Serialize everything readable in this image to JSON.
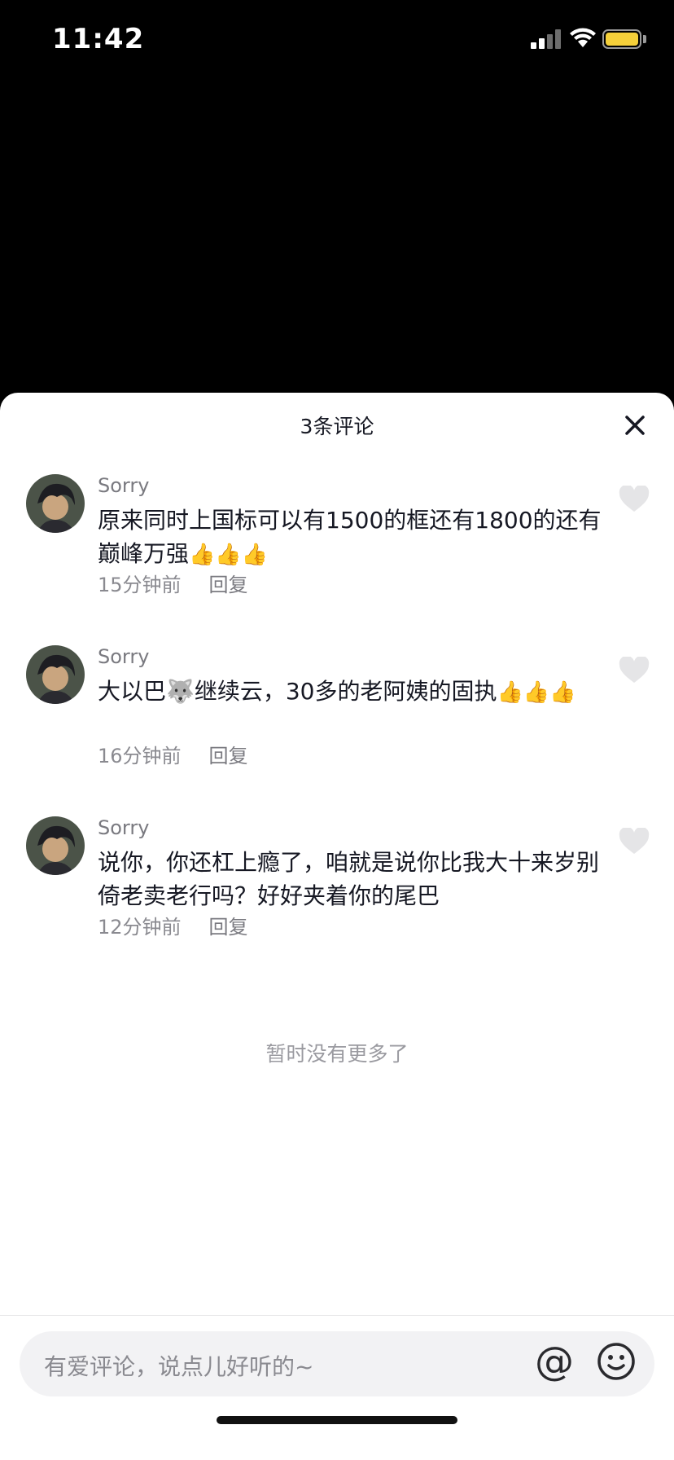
{
  "status": {
    "time": "11:42"
  },
  "sheet": {
    "title": "3条评论"
  },
  "comments": [
    {
      "user": "Sorry",
      "text": "原来同时上国标可以有1500的框还有1800的还有巅峰万强",
      "emoji": "👍👍👍",
      "time": "15分钟前",
      "reply": "回复"
    },
    {
      "user": "Sorry",
      "text": "大以巴🐺继续云，30多的老阿姨的固执",
      "emoji": "👍👍👍",
      "time": "16分钟前",
      "reply": "回复"
    },
    {
      "user": "Sorry",
      "text": "说你，你还杠上瘾了，咱就是说你比我大十来岁别倚老卖老行吗？好好夹着你的尾巴",
      "emoji": "",
      "time": "12分钟前",
      "reply": "回复"
    }
  ],
  "footer": {
    "no_more": "暂时没有更多了"
  },
  "input": {
    "placeholder": "有爱评论，说点儿好听的~"
  },
  "icons": {
    "at": "@",
    "emoji": "smiley-icon",
    "like": "heart-icon",
    "close": "close-icon"
  },
  "colors": {
    "battery": "#f5d03a",
    "text": "#161823",
    "muted": "#8a8a90"
  }
}
